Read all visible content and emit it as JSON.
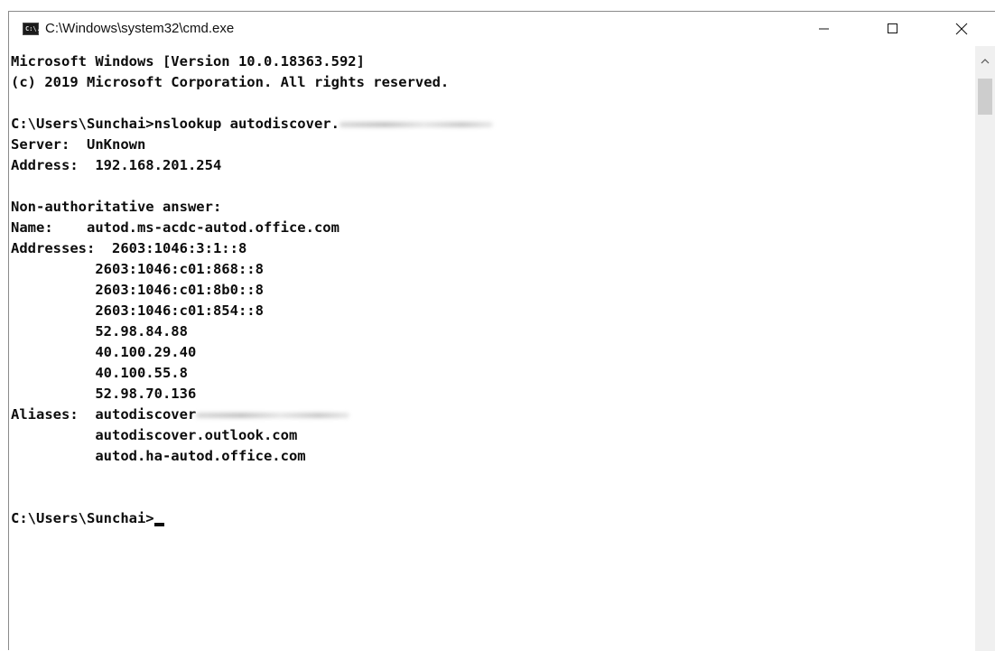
{
  "window": {
    "title": "C:\\Windows\\system32\\cmd.exe",
    "icon_label": "C:\\."
  },
  "console": {
    "lines": [
      "Microsoft Windows [Version 10.0.18363.592]",
      "(c) 2019 Microsoft Corporation. All rights reserved.",
      "",
      "C:\\Users\\Sunchai>nslookup autodiscover.",
      "Server:  UnKnown",
      "Address:  192.168.201.254",
      "",
      "Non-authoritative answer:",
      "Name:    autod.ms-acdc-autod.office.com",
      "Addresses:  2603:1046:3:1::8",
      "          2603:1046:c01:868::8",
      "          2603:1046:c01:8b0::8",
      "          2603:1046:c01:854::8",
      "          52.98.84.88",
      "          40.100.29.40",
      "          40.100.55.8",
      "          52.98.70.136",
      "Aliases:  autodiscover",
      "          autodiscover.outlook.com",
      "          autod.ha-autod.office.com",
      "",
      "",
      "C:\\Users\\Sunchai>"
    ]
  },
  "icons": {
    "minimize": "minimize-icon",
    "maximize": "maximize-icon",
    "close": "close-icon",
    "scroll_up": "chevron-up-icon",
    "app": "cmd-app-icon"
  }
}
